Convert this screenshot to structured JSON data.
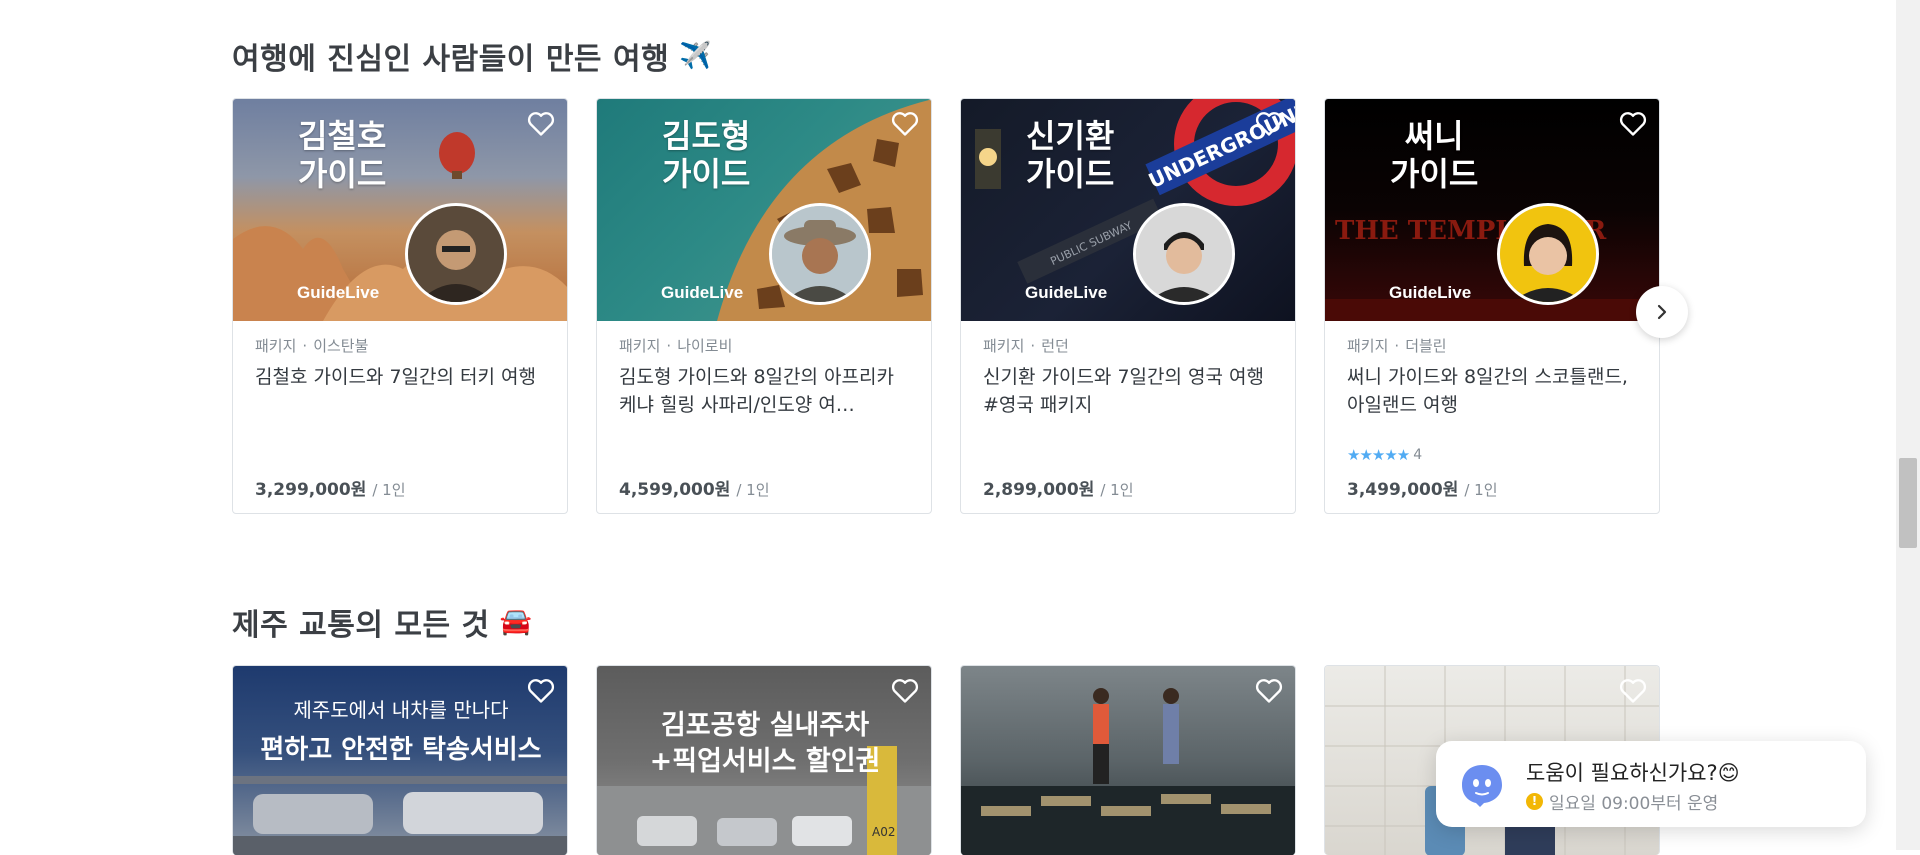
{
  "sections": [
    {
      "title": "여행에 진심인 사람들이 만든 여행",
      "title_emoji": "✈️",
      "cards": [
        {
          "thumb_text_line1": "김철호",
          "thumb_text_line2": "가이드",
          "brand": "GuideLive",
          "category": "패키지",
          "city": "이스탄불",
          "title": "김철호 가이드와 7일간의 터키 여행",
          "price": "3,299,000원",
          "per": "/ 1인"
        },
        {
          "thumb_text_line1": "김도형",
          "thumb_text_line2": "가이드",
          "brand": "GuideLive",
          "category": "패키지",
          "city": "나이로비",
          "title": "김도형 가이드와 8일간의 아프리카 케냐 힐링 사파리/인도양 여…",
          "price": "4,599,000원",
          "per": "/ 1인"
        },
        {
          "thumb_text_line1": "신기환",
          "thumb_text_line2": "가이드",
          "brand": "GuideLive",
          "sign_text": "UNDERGROUND",
          "street_text": "PUBLIC SUBWAY",
          "category": "패키지",
          "city": "런던",
          "title": "신기환 가이드와 7일간의 영국 여행 #영국 패키지",
          "price": "2,899,000원",
          "per": "/ 1인"
        },
        {
          "thumb_text_line1": "써니",
          "thumb_text_line2": "가이드",
          "brand": "GuideLive",
          "neon_text": "THE TEMPLE BAR",
          "category": "패키지",
          "city": "더블린",
          "title": "써니 가이드와 8일간의 스코틀랜드, 아일랜드 여행",
          "rating_count": "4",
          "rating_value": 5,
          "price": "3,499,000원",
          "per": "/ 1인"
        }
      ]
    },
    {
      "title": "제주 교통의 모든 것",
      "title_emoji": "🚘",
      "cards": [
        {
          "thumb_text_line1": "제주도에서 내차를 만나다",
          "thumb_text_line2": "편하고 안전한 탁송서비스"
        },
        {
          "thumb_text_line1": "김포공항 실내주차",
          "thumb_text_line2": "+픽업서비스 할인권",
          "sign_text": "A02"
        },
        {},
        {}
      ]
    }
  ],
  "help_widget": {
    "title": "도움이 필요하신가요?",
    "emoji": "😊",
    "subtitle": "일요일 09:00부터 운영",
    "warn_mark": "!"
  },
  "icons": {
    "heart": "heart-outline-icon",
    "next": "chevron-right-icon",
    "bot": "chatbot-icon"
  },
  "colors": {
    "star": "#51abf3",
    "warning": "#f2b705",
    "bot": "#6b8ef0"
  }
}
